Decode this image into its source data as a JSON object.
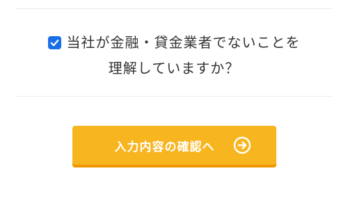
{
  "consent": {
    "checked": true,
    "line1": "当社が金融・貸金業者でないことを",
    "line2": "理解していますか？"
  },
  "cta": {
    "label": "入力内容の確認へ",
    "icon": "arrow-right-circle-icon"
  },
  "colors": {
    "checkbox": "#1a6fe6",
    "button": "#f7b51f",
    "button_shadow": "#f29600",
    "text": "#333333",
    "divider": "#ececec"
  }
}
